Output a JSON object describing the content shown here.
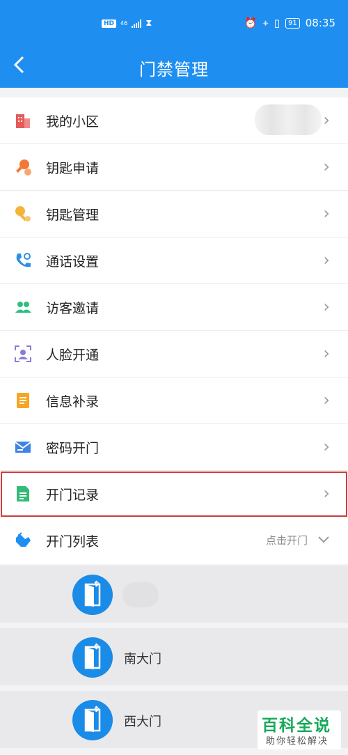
{
  "status_bar": {
    "hd": "HD",
    "network": "46",
    "time": "08:35",
    "battery": "91"
  },
  "header": {
    "title": "门禁管理",
    "back_icon": "chevron-left-icon"
  },
  "menu": [
    {
      "label": "我的小区",
      "icon": "building-icon",
      "color": "#e55b5b"
    },
    {
      "label": "钥匙申请",
      "icon": "key-apply-icon",
      "color": "#f27935"
    },
    {
      "label": "钥匙管理",
      "icon": "key-settings-icon",
      "color": "#f4b43a"
    },
    {
      "label": "通话设置",
      "icon": "phone-settings-icon",
      "color": "#2c8fe6"
    },
    {
      "label": "访客邀请",
      "icon": "visitors-icon",
      "color": "#2dbf7f"
    },
    {
      "label": "人脸开通",
      "icon": "face-scan-icon",
      "color": "#8d7bd8"
    },
    {
      "label": "信息补录",
      "icon": "document-icon",
      "color": "#f5a623"
    },
    {
      "label": "密码开门",
      "icon": "mail-icon",
      "color": "#3e83e6"
    },
    {
      "label": "开门记录",
      "icon": "record-icon",
      "color": "#33bb77"
    }
  ],
  "open_list": {
    "label": "开门列表",
    "icon": "hand-tap-icon",
    "action": "点击开门"
  },
  "doors": [
    {
      "name": ""
    },
    {
      "name": "南大门"
    },
    {
      "name": "西大门"
    }
  ],
  "watermark": {
    "title": "百科全说",
    "subtitle": "助你轻松解决"
  }
}
